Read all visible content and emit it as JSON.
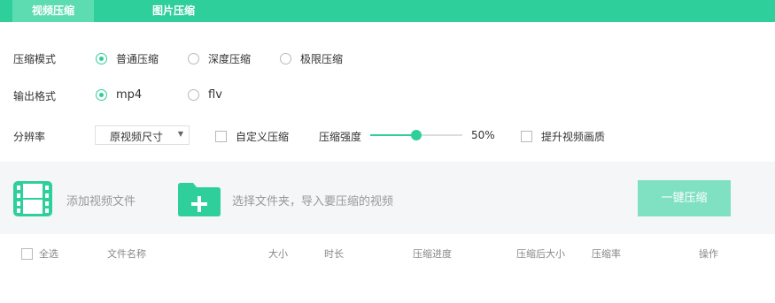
{
  "tabs": [
    {
      "label": "视频压缩",
      "active": true
    },
    {
      "label": "图片压缩",
      "active": false
    }
  ],
  "compress_mode": {
    "label": "压缩模式",
    "options": [
      "普通压缩",
      "深度压缩",
      "极限压缩"
    ],
    "selected": "普通压缩"
  },
  "output_format": {
    "label": "输出格式",
    "options": [
      "mp4",
      "flv"
    ],
    "selected": "mp4"
  },
  "resolution": {
    "label": "分辨率",
    "selected": "原视频尺寸",
    "custom_compress_label": "自定义压缩",
    "strength_label": "压缩强度",
    "strength_value": "50%",
    "strength_level": 0.5,
    "enhance_label": "提升视频画质"
  },
  "actions": {
    "add_file_label": "添加视频文件",
    "import_folder_label": "选择文件夹，导入要压缩的视频",
    "compress_button": "一键压缩"
  },
  "table": {
    "select_all": "全选",
    "headers": [
      "文件名称",
      "大小",
      "时长",
      "压缩进度",
      "压缩后大小",
      "压缩率",
      "操作"
    ]
  },
  "colors": {
    "accent": "#2fcf9b",
    "tab_active": "#5ddcb2",
    "button": "#7fe0c2"
  },
  "icons": {
    "add_file": "film-icon",
    "import_folder": "folder-plus-icon"
  }
}
